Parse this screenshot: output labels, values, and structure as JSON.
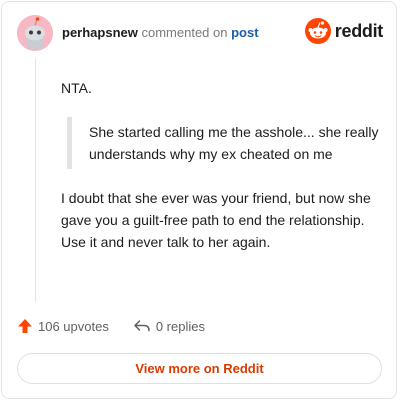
{
  "header": {
    "username": "perhapsnew",
    "action_text": "commented on",
    "target_link": "post"
  },
  "brand": {
    "logo_text": "reddit",
    "logo_icon": "reddit-snoo-icon",
    "logo_color": "#ff4500"
  },
  "comment": {
    "paragraph_1": "NTA.",
    "quote": "She started calling me the asshole... she really understands why my ex cheated on me",
    "paragraph_2": "I doubt that she ever was your friend, but now she gave you a guilt-free path to end the relationship. Use it and never talk to her again."
  },
  "actions": {
    "upvotes_label": "106 upvotes",
    "upvote_icon": "upvote-arrow-icon",
    "replies_label": "0 replies",
    "reply_icon": "reply-arrow-icon"
  },
  "footer": {
    "view_more_label": "View more on Reddit"
  },
  "colors": {
    "accent": "#d93a00",
    "upvote": "#ff4500",
    "avatar_bg": "#f7b8c3"
  }
}
